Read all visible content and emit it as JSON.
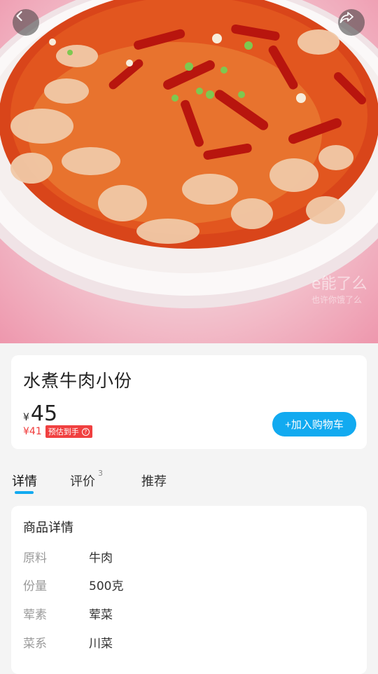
{
  "nav": {
    "back_icon": "chevron-left-icon",
    "share_icon": "share-arrow-icon"
  },
  "hero": {
    "watermark": "e能了么",
    "watermark_sub": "也许你饿了么"
  },
  "product": {
    "name": "水煮牛肉小份",
    "price_symbol": "¥",
    "price": "45",
    "estimated_price": "¥41",
    "estimate_label": "预估到手",
    "estimate_help_icon": "question-circle-icon",
    "add_to_cart_label": "+加入购物车"
  },
  "tabs": {
    "detail": "详情",
    "reviews": "评价",
    "reviews_count": "3",
    "recommend": "推荐"
  },
  "details": {
    "title": "商品详情",
    "specs": [
      {
        "label": "原料",
        "value": "牛肉"
      },
      {
        "label": "份量",
        "value": "500克"
      },
      {
        "label": "荤素",
        "value": " 荤菜"
      },
      {
        "label": "菜系",
        "value": " 川菜"
      }
    ]
  },
  "colors": {
    "accent": "#12aaf0",
    "price_red": "#f03a3a"
  }
}
